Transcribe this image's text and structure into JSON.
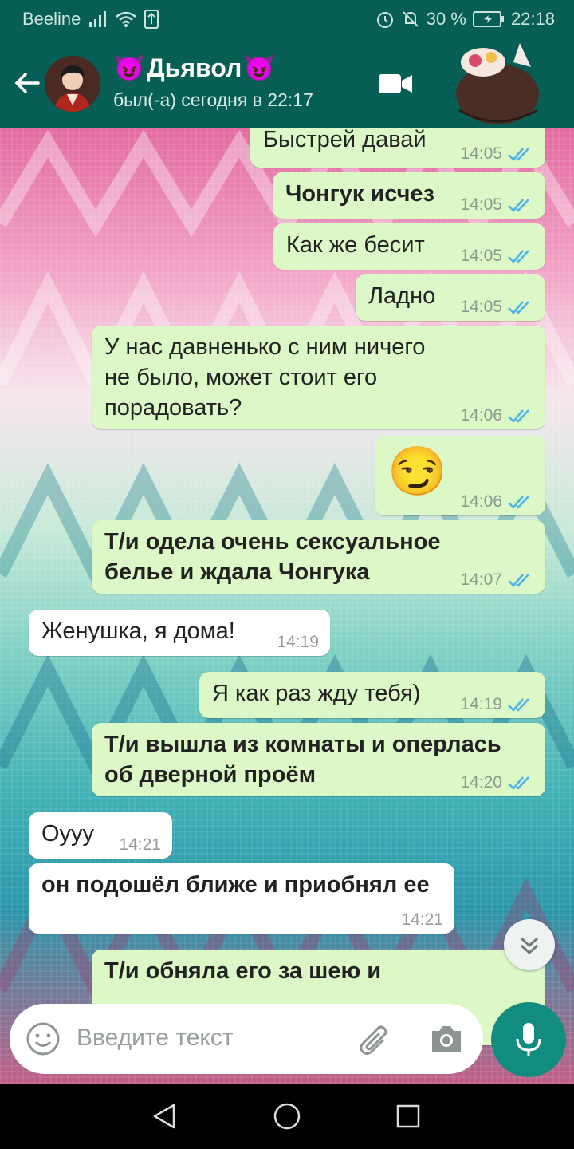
{
  "status_bar": {
    "carrier": "Beeline",
    "battery": "30 %",
    "time": "22:18"
  },
  "header": {
    "name": "Дьявол",
    "emoji_left": "😈",
    "emoji_right": "😈",
    "status": "был(-а) сегодня в 22:17"
  },
  "messages": [
    {
      "text": "Быстрей давай",
      "time": "14:05"
    },
    {
      "text": "Чонгук исчез",
      "time": "14:05"
    },
    {
      "text": "Как же бесит",
      "time": "14:05"
    },
    {
      "text": "Ладно",
      "time": "14:05"
    },
    {
      "line1": "У нас давненько с ним ничего",
      "line2": "не было, может стоит его",
      "line3": "порадовать?",
      "time": "14:06"
    },
    {
      "text": "😏",
      "time": "14:06"
    },
    {
      "line1": "Т/и одела очень сексуальное",
      "line2": "белье и ждала Чонгука",
      "time": "14:07"
    },
    {
      "text": "Женушка, я дома!",
      "time": "14:19"
    },
    {
      "text": "Я как раз жду тебя)",
      "time": "14:19"
    },
    {
      "line1": "Т/и вышла из комнаты и оперлась",
      "line2": "об дверной проём",
      "time": "14:20"
    },
    {
      "text": "Оууу",
      "time": "14:21"
    },
    {
      "text": "он подошёл ближе и приобнял ее",
      "time": "14:21"
    },
    {
      "text": "Т/и обняла его за шею и",
      "time": ""
    }
  ],
  "input": {
    "placeholder": "Введите текст"
  },
  "colors": {
    "header": "#075e54",
    "outgoing": "#dcf8c6",
    "incoming": "#ffffff",
    "read_ticks": "#4fb3e8",
    "mic": "#128c7e"
  }
}
